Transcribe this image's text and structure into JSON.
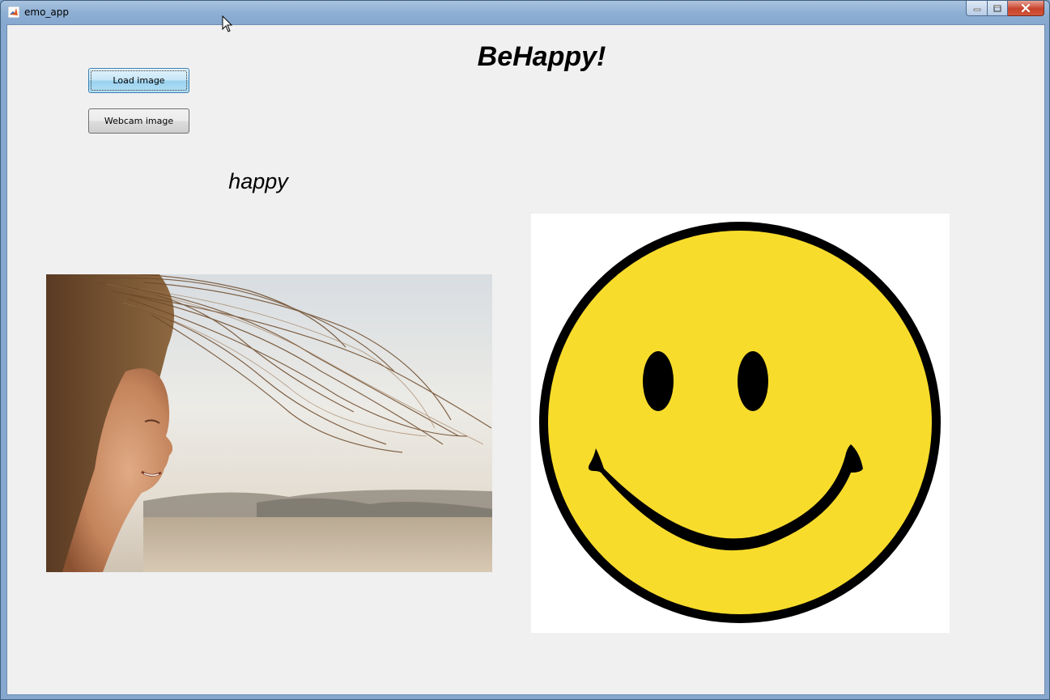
{
  "window": {
    "title": "emo_app",
    "icon": "matlab-icon",
    "controls": [
      "minimize-icon",
      "maximize-icon",
      "close-icon"
    ]
  },
  "app": {
    "title": "BeHappy!",
    "buttons": {
      "load_image": "Load image",
      "webcam_image": "Webcam image"
    },
    "detected_emotion": "happy"
  },
  "images": {
    "input_photo": "photo",
    "result_emoji": "smiley-face-icon"
  },
  "colors": {
    "emoji_yellow": "#f8dc2c",
    "emoji_outline": "#000000",
    "client_background": "#f0f0f0",
    "close_button": "#c7432b"
  }
}
